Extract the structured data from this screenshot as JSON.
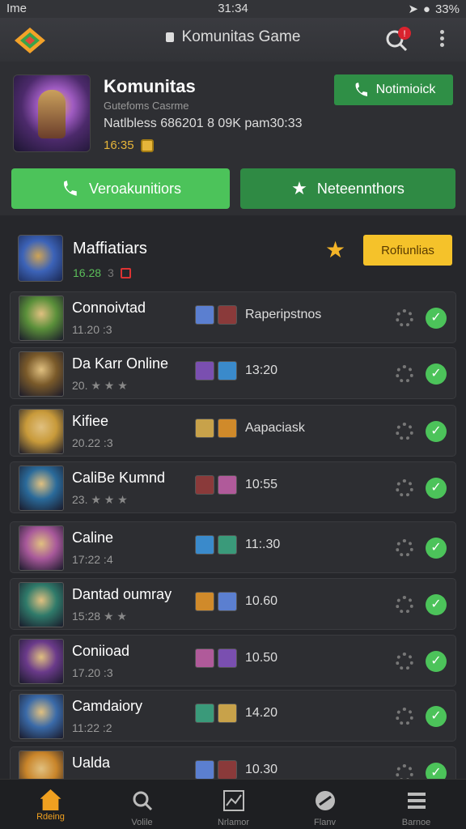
{
  "statusbar": {
    "left": "Ime",
    "time": "31:34",
    "battery": "33%"
  },
  "appbar": {
    "title": "Komunitas Game",
    "badge": "!"
  },
  "header": {
    "title": "Komunitas",
    "subtitle": "Gutefoms Casrme",
    "stats": "Natlbless 686201 8 09K pam30:33",
    "time": "16:35",
    "notify_label": "Notimioick",
    "btn_primary": "Veroakunitiors",
    "btn_secondary": "Neteennthors"
  },
  "featured": {
    "title": "Maffiatiars",
    "sub": "16.28",
    "sub2": "3",
    "badge_label": "Rofiunlias"
  },
  "rows": [
    {
      "name": "Connoivtad",
      "sub": "11.20 :3",
      "mid": "Raperipstnos",
      "thumb": "#5a8f3a"
    },
    {
      "name": "Da Karr Online",
      "sub": "20.",
      "stars": "★ ★ ★",
      "mid": "13:20",
      "thumb": "#7a5a2a"
    },
    {
      "name": "Kifiee",
      "sub": "20.22 :3",
      "mid": "Aapaciask",
      "thumb": "#c89a3a"
    },
    {
      "name": "CaliBe Kumnd",
      "sub": "23.",
      "stars": "★ ★ ★",
      "mid": "10:55",
      "thumb": "#2a6a9a"
    },
    {
      "name": "Caline",
      "sub": "17:22 :4",
      "mid": "11:.30",
      "thumb": "#a7589a"
    },
    {
      "name": "Dantad oumray",
      "sub": "15:28",
      "stars": "★ ★",
      "mid": "10.60",
      "thumb": "#2f7a6a"
    },
    {
      "name": "Coniioad",
      "sub": "17.20 :3",
      "mid": "10.50",
      "thumb": "#6a3a8a"
    },
    {
      "name": "Camdaiory",
      "sub": "11:22 :2",
      "mid": "14.20",
      "thumb": "#3a6aa8"
    },
    {
      "name": "Ualda",
      "sub": "",
      "mid": "10.30",
      "thumb": "#c9852a"
    }
  ],
  "nav": [
    {
      "label": "Rdeing",
      "icon": "home-icon"
    },
    {
      "label": "Volile",
      "icon": "search-icon"
    },
    {
      "label": "Nrlamor",
      "icon": "chart-icon"
    },
    {
      "label": "Flanv",
      "icon": "disc-icon"
    },
    {
      "label": "Barnoe",
      "icon": "menu-icon"
    }
  ],
  "colors": {
    "green": "#4cc35a",
    "dark_green": "#2f8a44",
    "gold": "#f5c22a",
    "accent": "#f0a020"
  }
}
